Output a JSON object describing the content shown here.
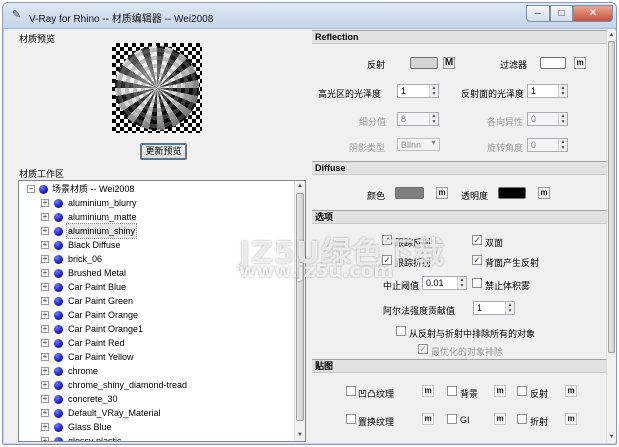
{
  "window": {
    "title": "V-Ray for Rhino -- 材质编辑器 -- Wei2008",
    "min_glyph": "–",
    "max_glyph": "□",
    "close_glyph": "✕"
  },
  "left": {
    "preview_label": "材质预览",
    "update_button": "更新预览",
    "workspace_label": "材质工作区",
    "tree": {
      "root": "场景材质 -- Wei2008",
      "items": [
        "aluminium_blurry",
        "aluminium_matte",
        "aluminium_shiny",
        "Black Diffuse",
        "brick_06",
        "Brushed Metal",
        "Car Paint Blue",
        "Car Paint Green",
        "Car Paint Orange",
        "Car Paint Orange1",
        "Car Paint Red",
        "Car Paint Yellow",
        "chrome",
        "chrome_shiny_diamond-tread",
        "concrete_30",
        "Default_VRay_Material",
        "Glass Blue",
        "glossy plastic"
      ],
      "selected": "aluminium_shiny"
    }
  },
  "reflection": {
    "header": "Reflection",
    "reflect_label": "反射",
    "filter_label": "过滤器",
    "hilight_gloss_label": "高光区的光泽度",
    "hilight_gloss_value": "1",
    "refl_gloss_label": "反射面的光泽度",
    "refl_gloss_value": "1",
    "subdivs_label": "细分值",
    "subdivs_value": "8",
    "aniso_label": "各向异性",
    "aniso_value": "0",
    "brdf_label": "阴影类型",
    "brdf_value": "Blinn",
    "rotation_label": "旋转角度",
    "rotation_value": "0",
    "m": "m",
    "M": "M",
    "swatch_reflect": "#d4d4d4",
    "swatch_filter": "#ffffff"
  },
  "diffuse": {
    "header": "Diffuse",
    "color_label": "颜色",
    "transparency_label": "透明度",
    "m": "m",
    "swatch_color": "#7f7f7f",
    "swatch_transparency": "#000000"
  },
  "options": {
    "header": "选项",
    "trace_reflections": "跟踪反射",
    "double_sided": "双面",
    "trace_refractions": "跟踪折射",
    "reflect_on_back": "背面产生反射",
    "cutoff_label": "中止阈值",
    "cutoff_value": "0.01",
    "no_volume_fog": "禁止体积雾",
    "alpha_contribution_label": "阿尔法强度贡献值",
    "alpha_contribution_value": "1",
    "exclude_all_label": "从反射与折射中排除所有的对象",
    "optimized_exclusion_label": "最优化的对象排除",
    "check_mark": "✓"
  },
  "maps": {
    "header": "贴图",
    "bump": "凹凸纹理",
    "background": "背景",
    "reflection": "反射",
    "displacement": "置换纹理",
    "gi": "GI",
    "refraction": "折射",
    "m": "m"
  },
  "watermark": {
    "line1": "JZ5U绿色下载",
    "line2": "www.jz5u.com"
  }
}
